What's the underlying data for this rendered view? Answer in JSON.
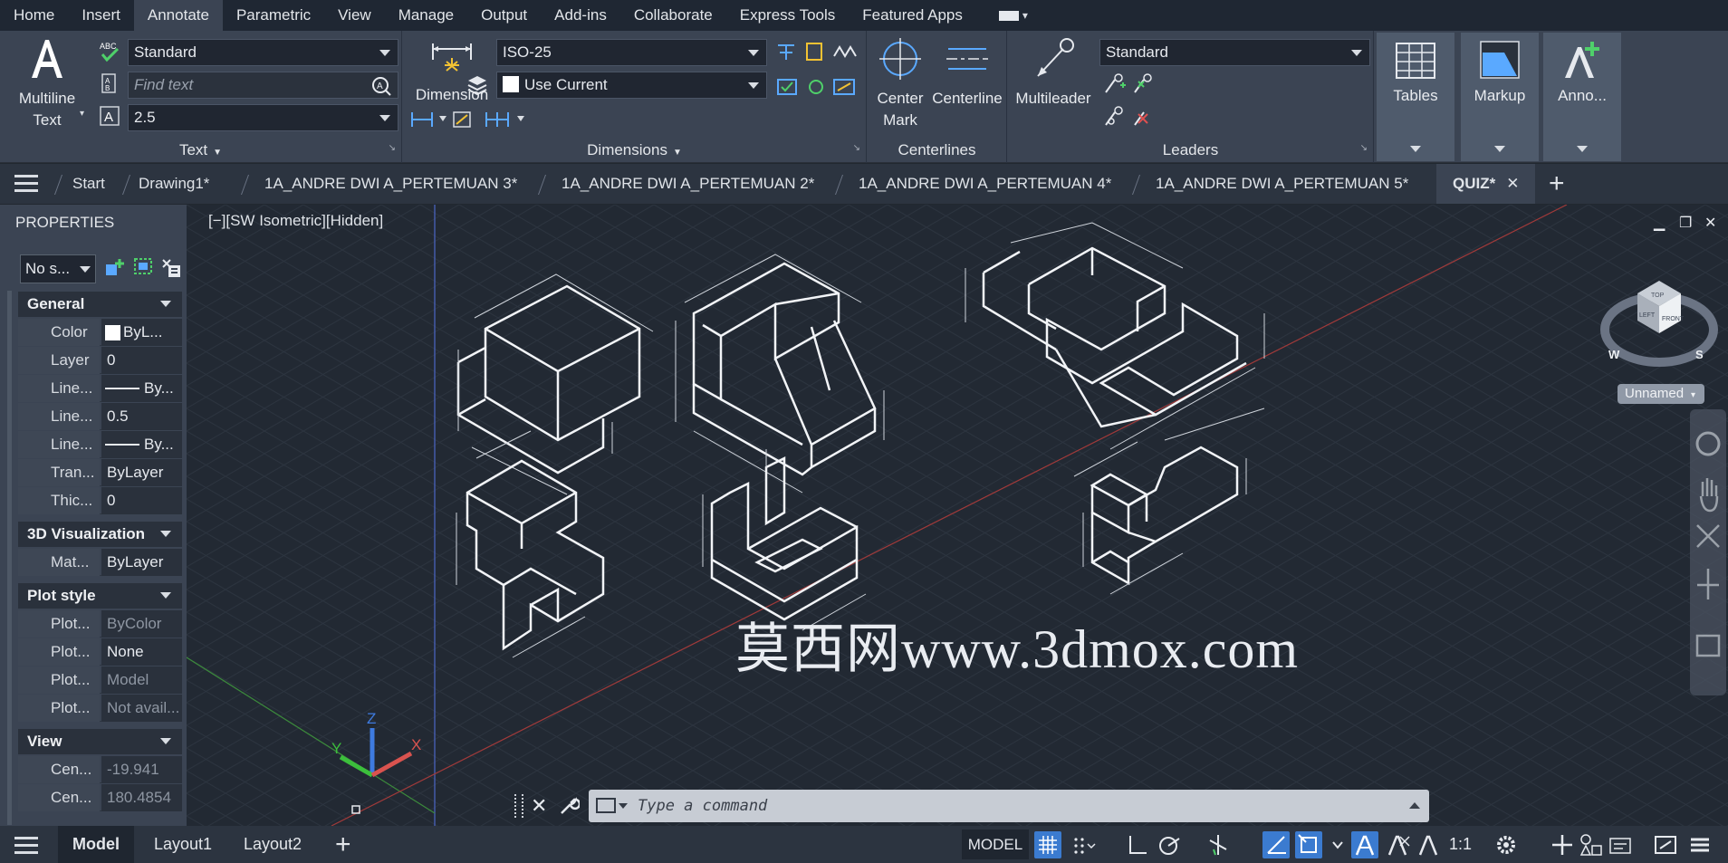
{
  "ribbon_tabs": [
    "Home",
    "Insert",
    "Annotate",
    "Parametric",
    "View",
    "Manage",
    "Output",
    "Add-ins",
    "Collaborate",
    "Express Tools",
    "Featured Apps"
  ],
  "active_ribbon_tab": "Annotate",
  "text_panel": {
    "multiline_text_line1": "Multiline",
    "multiline_text_line2": "Text",
    "style": "Standard",
    "find_placeholder": "Find text",
    "height": "2.5",
    "title": "Text"
  },
  "dimensions_panel": {
    "dimension_label": "Dimension",
    "dim_style": "ISO-25",
    "layer": "Use Current",
    "title": "Dimensions"
  },
  "centerlines_panel": {
    "center_mark_line1": "Center",
    "center_mark_line2": "Mark",
    "centerline": "Centerline",
    "title": "Centerlines"
  },
  "leaders_panel": {
    "multileader": "Multileader",
    "style": "Standard",
    "title": "Leaders"
  },
  "tables_label": "Tables",
  "markup_label": "Markup",
  "annotation_label": "Anno...",
  "doc_tabs": [
    "Start",
    "Drawing1*",
    "1A_ANDRE DWI A_PERTEMUAN 3*",
    "1A_ANDRE DWI A_PERTEMUAN 2*",
    "1A_ANDRE DWI A_PERTEMUAN 4*",
    "1A_ANDRE DWI A_PERTEMUAN 5*"
  ],
  "active_doc_tab": "QUIZ*",
  "properties": {
    "title": "PROPERTIES",
    "selection": "No s...",
    "sections": {
      "general": "General",
      "visualization": "3D Visualization",
      "plot_style": "Plot style",
      "view": "View"
    },
    "general": [
      {
        "key": "Color",
        "value": "ByL..."
      },
      {
        "key": "Layer",
        "value": "0"
      },
      {
        "key": "Line...",
        "value": "By..."
      },
      {
        "key": "Line...",
        "value": "0.5"
      },
      {
        "key": "Line...",
        "value": "By..."
      },
      {
        "key": "Tran...",
        "value": "ByLayer"
      },
      {
        "key": "Thic...",
        "value": "0"
      }
    ],
    "visualization": [
      {
        "key": "Mat...",
        "value": "ByLayer"
      }
    ],
    "plot": [
      {
        "key": "Plot...",
        "value": "ByColor"
      },
      {
        "key": "Plot...",
        "value": "None"
      },
      {
        "key": "Plot...",
        "value": "Model"
      },
      {
        "key": "Plot...",
        "value": "Not avail..."
      }
    ],
    "view": [
      {
        "key": "Cen...",
        "value": "-19.941"
      },
      {
        "key": "Cen...",
        "value": "180.4854"
      }
    ]
  },
  "viewport": {
    "label": "[−][SW Isometric][Hidden]",
    "ucs_name": "Unnamed",
    "viewcube": {
      "top": "TOP",
      "left": "LEFT",
      "front": "FRONT",
      "west": "W",
      "south": "S"
    },
    "axis_labels": {
      "x": "X",
      "y": "Y",
      "z": "Z"
    },
    "watermark": "莫西网www.3dmox.com"
  },
  "command_placeholder": "Type a command",
  "layout_tabs": [
    "Model",
    "Layout1",
    "Layout2"
  ],
  "status": {
    "model": "MODEL",
    "scale": "1:1"
  },
  "colors": {
    "accent": "#3b7bd0",
    "background": "#222933",
    "ribbon": "#3b4453"
  }
}
